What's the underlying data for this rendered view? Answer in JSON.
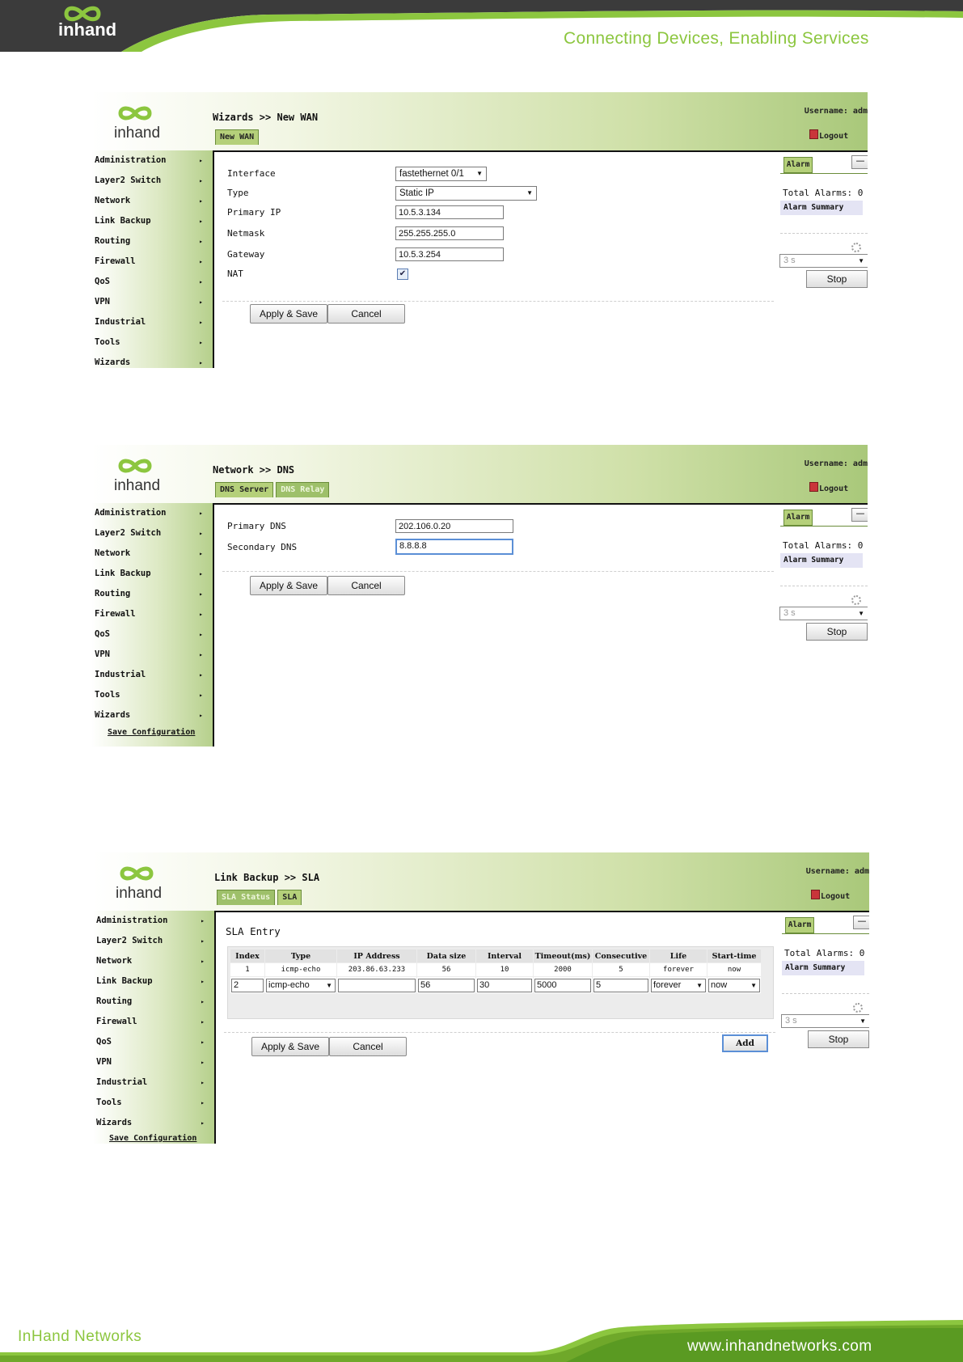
{
  "page": {
    "tagline": "Connecting Devices, Enabling Services",
    "footer_company": "InHand Networks",
    "footer_url": "www.inhandnetworks.com",
    "brand_logo_text": "inhand",
    "colors": {
      "brand_green": "#8cc63f",
      "header_dark": "#3a3a3a",
      "menu_green": "#b6d08c"
    }
  },
  "common": {
    "username_label": "Username: adm",
    "logout_label": "Logout",
    "alarm_tab": "Alarm",
    "minimize_symbol": "—",
    "total_alarms": "Total Alarms: 0",
    "alarm_summary": "Alarm Summary",
    "refresh_interval": "3 s",
    "stop_label": "Stop",
    "apply_save": "Apply & Save",
    "cancel": "Cancel",
    "save_configuration": "Save Configuration",
    "menu": [
      "Administration",
      "Layer2 Switch",
      "Network",
      "Link Backup",
      "Routing",
      "Firewall",
      "QoS",
      "VPN",
      "Industrial",
      "Tools",
      "Wizards"
    ],
    "menu_arrow": "▸",
    "select_caret": "▼",
    "checkbox_mark": "✔"
  },
  "shot1": {
    "breadcrumb": "Wizards >> New WAN",
    "tabs": [
      "New WAN"
    ],
    "fields": [
      {
        "label": "Interface",
        "value": "fastethernet 0/1"
      },
      {
        "label": "Type",
        "value": "Static IP"
      },
      {
        "label": "Primary IP",
        "value": "10.5.3.134"
      },
      {
        "label": "Netmask",
        "value": "255.255.255.0"
      },
      {
        "label": "Gateway",
        "value": "10.5.3.254"
      },
      {
        "label": "NAT",
        "value": true
      }
    ]
  },
  "shot2": {
    "breadcrumb": "Network >> DNS",
    "tabs": [
      "DNS Server",
      "DNS Relay"
    ],
    "fields": [
      {
        "label": "Primary DNS",
        "value": "202.106.0.20"
      },
      {
        "label": "Secondary DNS",
        "value": "8.8.8.8"
      }
    ]
  },
  "shot3": {
    "breadcrumb": "Link Backup >> SLA",
    "tabs": [
      "SLA Status",
      "SLA"
    ],
    "section_title": "SLA Entry",
    "columns": [
      "Index",
      "Type",
      "IP Address",
      "Data size",
      "Interval",
      "Timeout(ms)",
      "Consecutive",
      "Life",
      "Start-time"
    ],
    "row": [
      "1",
      "icmp-echo",
      "203.86.63.233",
      "56",
      "10",
      "2000",
      "5",
      "forever",
      "now"
    ],
    "edit_row": [
      "2",
      "icmp-echo",
      "",
      "56",
      "30",
      "5000",
      "5",
      "forever",
      "now"
    ],
    "add_label": "Add"
  }
}
